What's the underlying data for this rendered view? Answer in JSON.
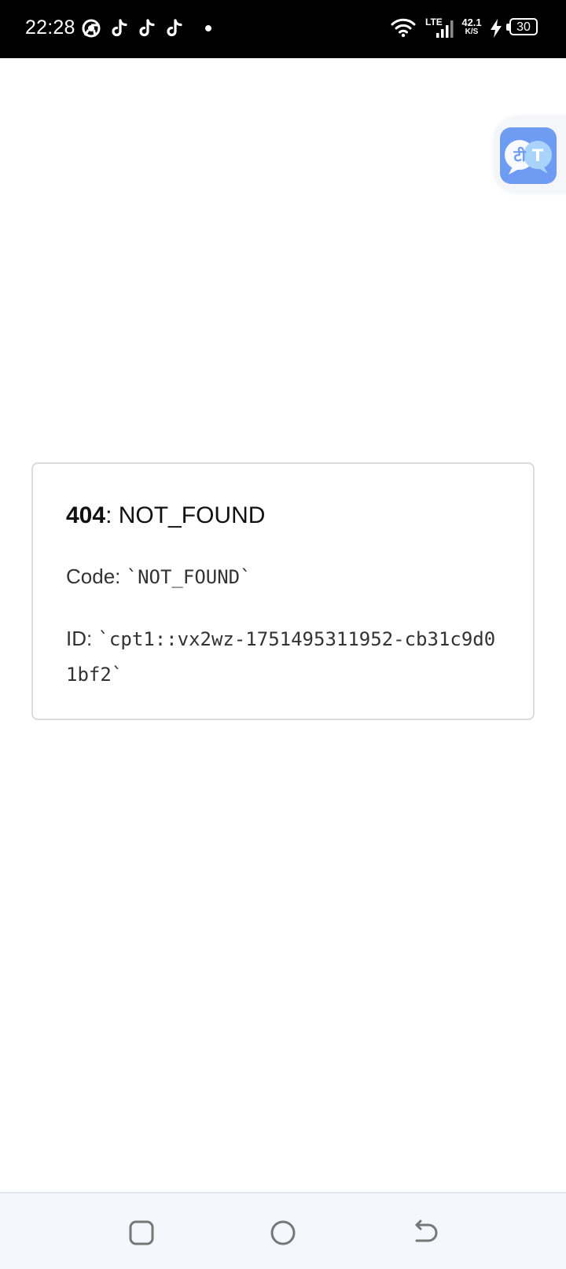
{
  "status_bar": {
    "time": "22:28",
    "notification_icons": [
      "chrome-icon",
      "tiktok-icon",
      "tiktok-icon",
      "tiktok-icon"
    ],
    "network_type": "LTE",
    "net_speed_value": "42.1",
    "net_speed_unit": "K/S",
    "battery_level": "30"
  },
  "error": {
    "status_code": "404",
    "status_separator": ": ",
    "status_text": "NOT_FOUND",
    "code_label": "Code:",
    "code_value": "`NOT_FOUND`",
    "id_label": "ID:",
    "id_value": "`cpt1::vx2wz-1751495311952-cb31c9d01bf2`"
  },
  "translate_bubble": {
    "icon": "translate-icon",
    "left_glyph": "टी",
    "right_glyph": "T"
  },
  "nav_bar": {
    "buttons": [
      "recents-button",
      "home-button",
      "back-button"
    ]
  },
  "colors": {
    "status_bar_bg": "#000000",
    "card_border": "#dddddd",
    "translate_accent": "#6e9cf2",
    "nav_bar_bg": "#f4f7fb"
  }
}
